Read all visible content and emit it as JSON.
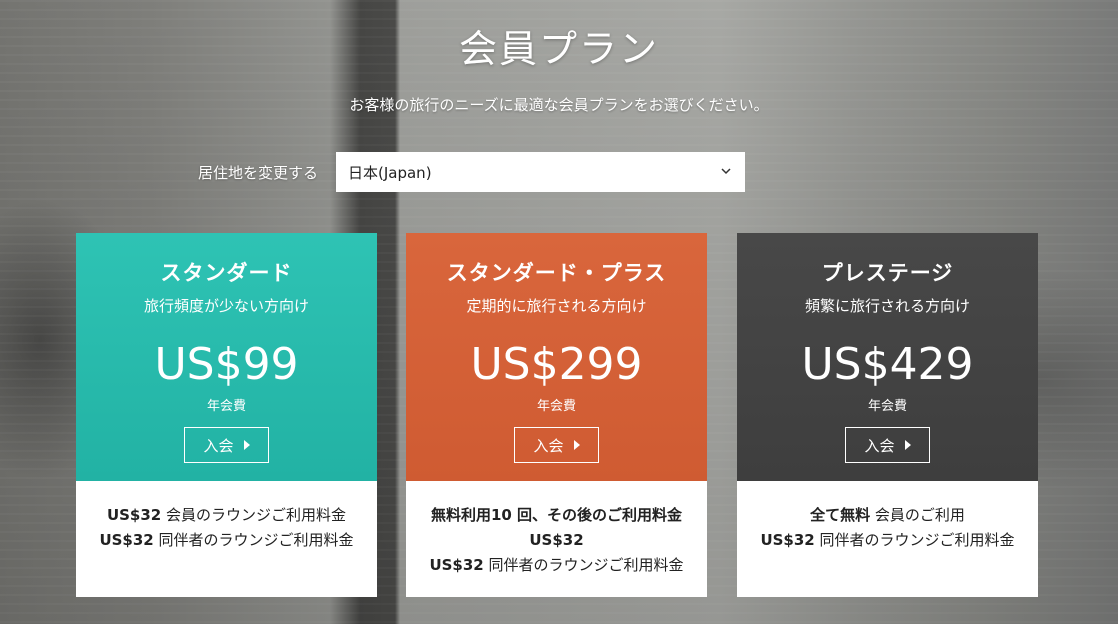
{
  "header": {
    "title": "会員プラン",
    "subtitle": "お客様の旅行のニーズに最適な会員プランをお選びください。"
  },
  "residence": {
    "label": "居住地を変更する",
    "selected": "日本(Japan)"
  },
  "plans": [
    {
      "name": "スタンダード",
      "tagline": "旅行頻度が少ない方向け",
      "price": "US$99",
      "period": "年会費",
      "join_label": "入会",
      "benefits": [
        {
          "bold": "US$32",
          "text": " 会員のラウンジご利用料金"
        },
        {
          "bold": "US$32",
          "text": " 同伴者のラウンジご利用料金"
        }
      ]
    },
    {
      "name": "スタンダード・プラス",
      "tagline": "定期的に旅行される方向け",
      "price": "US$299",
      "period": "年会費",
      "join_label": "入会",
      "benefits": [
        {
          "bold": "無料利用10 回、その後のご利用料金US$32",
          "text": ""
        },
        {
          "bold": "US$32",
          "text": " 同伴者のラウンジご利用料金"
        }
      ]
    },
    {
      "name": "プレステージ",
      "tagline": "頻繁に旅行される方向け",
      "price": "US$429",
      "period": "年会費",
      "join_label": "入会",
      "benefits": [
        {
          "bold": "全て無料",
          "text": " 会員のご利用"
        },
        {
          "bold": "US$32",
          "text": " 同伴者のラウンジご利用料金"
        }
      ]
    }
  ],
  "colors": {
    "standard": "#2ec3b4",
    "plus": "#d9663c",
    "prestige": "#484848"
  },
  "icons": {
    "select": "chevron-down-icon",
    "join": "triangle-right-icon"
  }
}
